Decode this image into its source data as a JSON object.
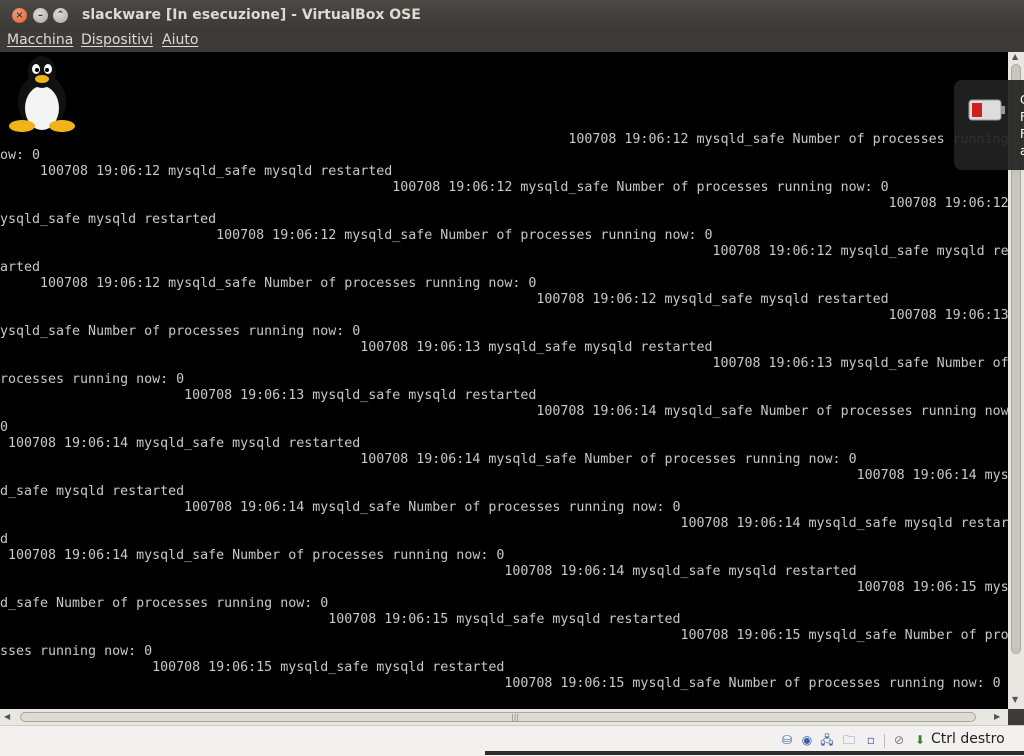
{
  "window": {
    "title": "slackware [In esecuzione] - VirtualBox OSE",
    "close_glyph": "×",
    "min_glyph": "–",
    "max_glyph": "⌃"
  },
  "menu": [
    "Macchina",
    "Dispositivi",
    "Aiuto"
  ],
  "console": {
    "lines": [
      "                                                                       100708 19:06:12 mysqld_safe Number of processes running",
      "ow: 0",
      "     100708 19:06:12 mysqld_safe mysqld restarted",
      "                                                 100708 19:06:12 mysqld_safe Number of processes running now: 0",
      "                                                                                                               100708 19:06:12",
      "ysqld_safe mysqld restarted",
      "                           100708 19:06:12 mysqld_safe Number of processes running now: 0",
      "                                                                                         100708 19:06:12 mysqld_safe mysqld re",
      "arted",
      "     100708 19:06:12 mysqld_safe Number of processes running now: 0",
      "                                                                   100708 19:06:12 mysqld_safe mysqld restarted",
      "                                                                                                               100708 19:06:13",
      "ysqld_safe Number of processes running now: 0",
      "                                             100708 19:06:13 mysqld_safe mysqld restarted",
      "                                                                                         100708 19:06:13 mysqld_safe Number of",
      "rocesses running now: 0",
      "                       100708 19:06:13 mysqld_safe mysqld restarted",
      "                                                                   100708 19:06:14 mysqld_safe Number of processes running now",
      "0",
      " 100708 19:06:14 mysqld_safe mysqld restarted",
      "                                             100708 19:06:14 mysqld_safe Number of processes running now: 0",
      "                                                                                                           100708 19:06:14 mys",
      "d_safe mysqld restarted",
      "                       100708 19:06:14 mysqld_safe Number of processes running now: 0",
      "                                                                                     100708 19:06:14 mysqld_safe mysqld restar",
      "d",
      " 100708 19:06:14 mysqld_safe Number of processes running now: 0",
      "                                                               100708 19:06:14 mysqld_safe mysqld restarted",
      "                                                                                                           100708 19:06:15 mys",
      "d_safe Number of processes running now: 0",
      "                                         100708 19:06:15 mysqld_safe mysqld restarted",
      "                                                                                     100708 19:06:15 mysqld_safe Number of pro",
      "sses running now: 0",
      "                   100708 19:06:15 mysqld_safe mysqld restarted",
      "                                                               100708 19:06:15 mysqld_safe Number of processes running now: 0"
    ]
  },
  "status": {
    "host_key": "Ctrl destro",
    "icons": [
      "hard-disk-icon",
      "optical-disk-icon",
      "network-icon",
      "shared-folder-icon",
      "usb-icon",
      "mouse-integration-icon",
      "host-key-icon"
    ]
  },
  "notification": {
    "text": [
      "C",
      "F",
      "F",
      "a"
    ]
  },
  "colors": {
    "console_bg": "#000000",
    "console_text": "#c8c8c8",
    "titlebar": "#3c3b37",
    "statusbar": "#f2f1ef"
  }
}
